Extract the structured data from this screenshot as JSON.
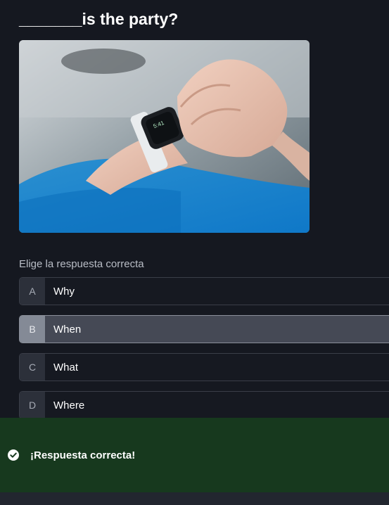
{
  "question": {
    "title": "_______is the party?"
  },
  "image": {
    "description_icon": "smartwatch-photo",
    "watch_time": "5:41"
  },
  "instruction": "Elige la respuesta correcta",
  "options": [
    {
      "letter": "A",
      "text": "Why",
      "selected": false
    },
    {
      "letter": "B",
      "text": "When",
      "selected": true
    },
    {
      "letter": "C",
      "text": "What",
      "selected": false
    },
    {
      "letter": "D",
      "text": "Where",
      "selected": false
    }
  ],
  "feedback": {
    "icon": "check-circle-icon",
    "text": "¡Respuesta correcta!",
    "color": "#17391e"
  },
  "colors": {
    "background": "#151820",
    "selected_option": "#454955"
  }
}
